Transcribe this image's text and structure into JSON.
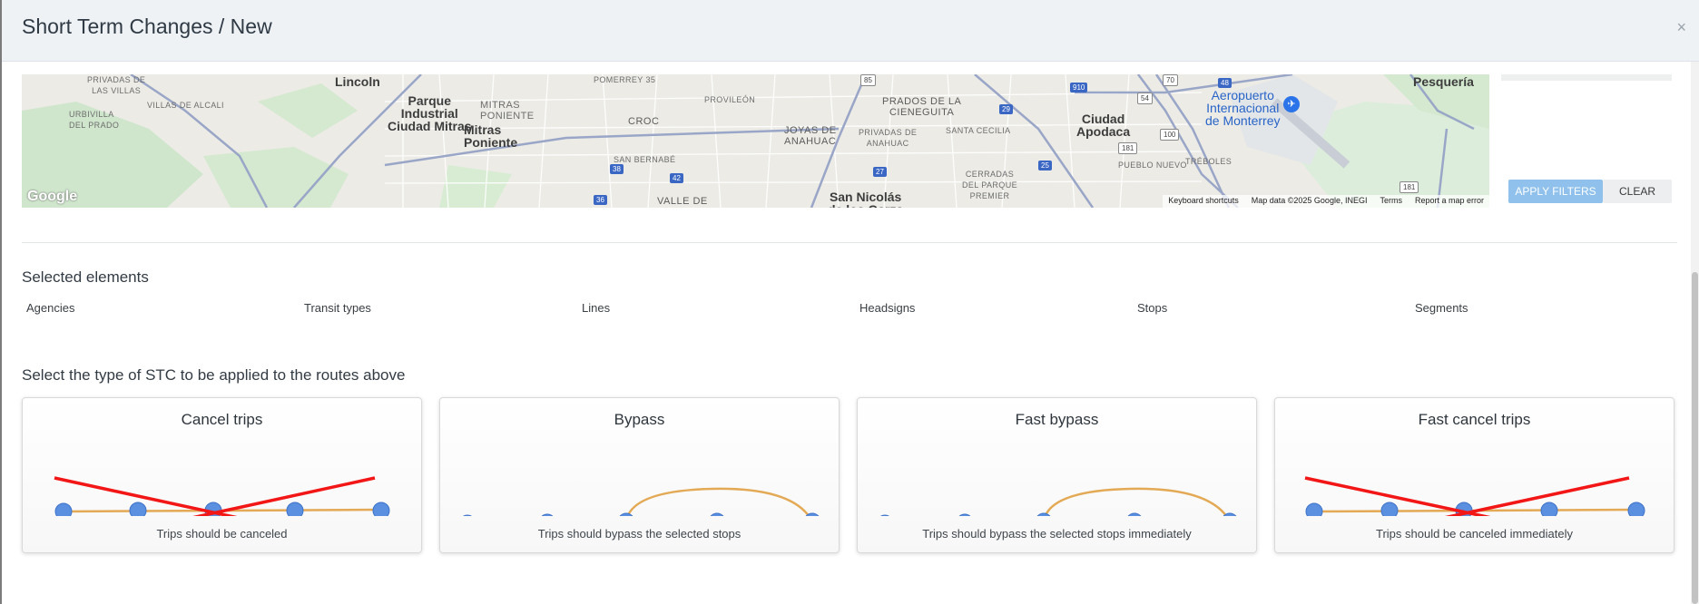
{
  "modal": {
    "title": "Short Term Changes / New",
    "close_label": "×"
  },
  "map": {
    "labels": {
      "privadas": "PRIVADAS DE\nLAS VILLAS",
      "urbivilla": "URBIVILLA\nDEL PRADO",
      "villas_alcali": "VILLAS DE ALCALI",
      "lincoln": "Lincoln",
      "parque": "Parque\nIndustrial\nCiudad Mitras",
      "mitras_poniente_caps": "MITRAS\nPONIENTE",
      "mitras_poniente": "Mitras\nPoniente",
      "pomerrey": "POMERREY 35",
      "provileon": "PROVILEÓN",
      "croc": "CROC",
      "san_bernabe": "SAN BERNABÉ",
      "valle": "VALLE DE",
      "joyas": "JOYAS DE\nANAHUAC",
      "privadas_anahuac": "PRIVADAS DE\nANAHUAC",
      "prados": "PRADOS DE LA\nCIENEGUITA",
      "santa_cecilia": "SANTA CECILIA",
      "cerradas": "CERRADAS\nDEL PARQUE\nPREMIER",
      "san_nicolas": "San Nicolás\nde los Garza",
      "ciudad_apodaca": "Ciudad\nApodaca",
      "pueblo_nuevo": "PUEBLO NUEVO",
      "treboles": "TRÉBOLES",
      "aeropuerto": "Aeropuerto\nInternacional\nde Monterrey",
      "pesqueria": "Pesquería"
    },
    "badges": {
      "b85": "85",
      "b910": "910",
      "b70": "70",
      "b48": "48",
      "b54": "54",
      "b29": "29",
      "b38": "38",
      "b42": "42",
      "b27": "27",
      "b25": "25",
      "b181a": "181",
      "b100": "100",
      "b181b": "181",
      "b36": "36"
    },
    "logo": "Google",
    "footer": {
      "shortcuts": "Keyboard shortcuts",
      "data": "Map data ©2025 Google, INEGI",
      "terms": "Terms",
      "report": "Report a map error"
    }
  },
  "filters": {
    "apply_label": "APPLY FILTERS",
    "clear_label": "CLEAR"
  },
  "selected": {
    "title": "Selected elements",
    "columns": [
      "Agencies",
      "Transit types",
      "Lines",
      "Headsigns",
      "Stops",
      "Segments"
    ]
  },
  "stc": {
    "title": "Select the type of STC to be applied to the routes above",
    "cards": [
      {
        "title": "Cancel trips",
        "description": "Trips should be canceled",
        "icon": "cancel-trips-diagram"
      },
      {
        "title": "Bypass",
        "description": "Trips should bypass the selected stops",
        "icon": "bypass-diagram"
      },
      {
        "title": "Fast bypass",
        "description": "Trips should bypass the selected stops immediately",
        "icon": "fast-bypass-diagram"
      },
      {
        "title": "Fast cancel trips",
        "description": "Trips should be canceled immediately",
        "icon": "fast-cancel-trips-diagram"
      }
    ]
  },
  "colors": {
    "stop_blue": "#5b8fe0",
    "route_orange": "#e3a955",
    "cross_red": "#f21616",
    "apply_button": "#8fc1ec"
  }
}
